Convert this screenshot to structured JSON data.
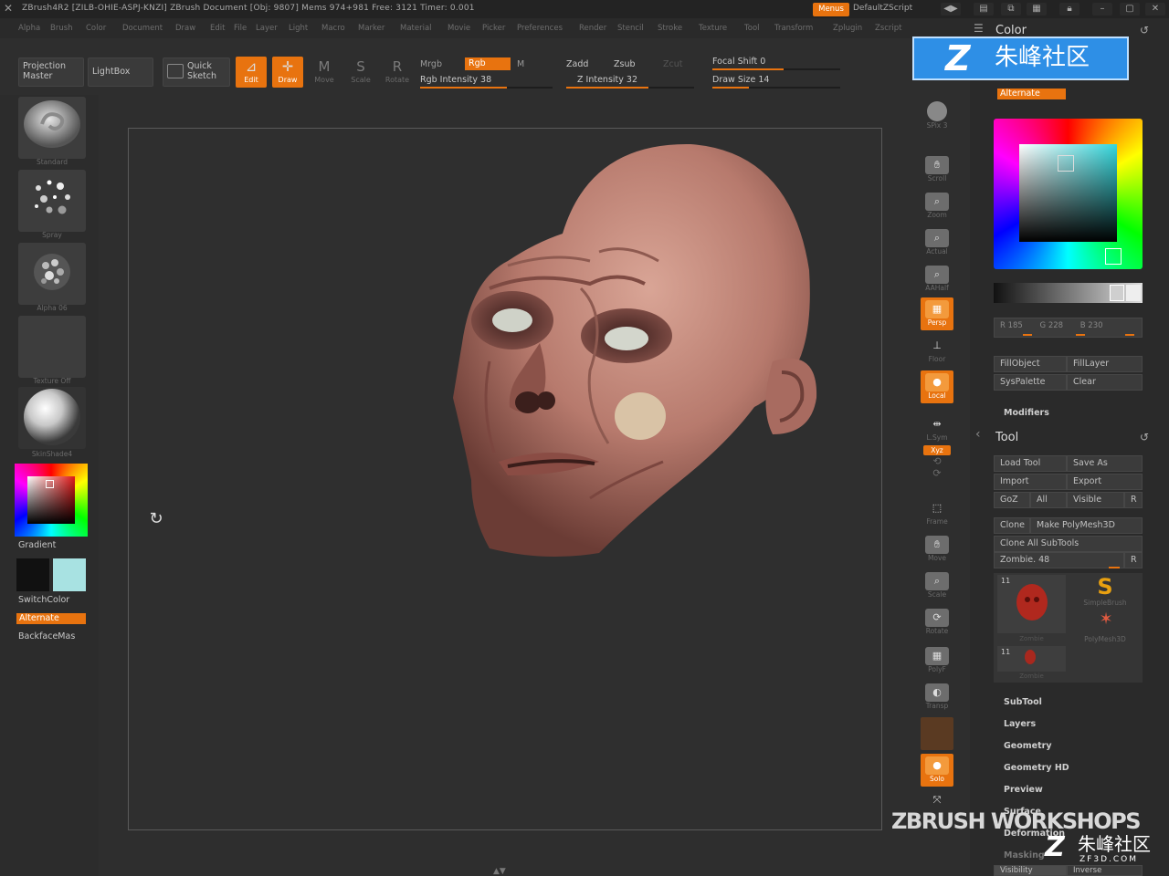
{
  "titlebar": {
    "text": "ZBrush4R2  [ZILB-OHIE-ASPJ-KNZI]    ZBrush Document     [Obj: 9807] Mems 974+981  Free: 3121  Timer: 0.001",
    "menus_label": "Menus",
    "script_label": "DefaultZScript"
  },
  "menubar": {
    "items": [
      "Alpha",
      "Brush",
      "Color",
      "Document",
      "Draw",
      "Edit",
      "File",
      "Layer",
      "Light",
      "Macro",
      "Marker",
      "Material",
      "Movie",
      "Picker",
      "Preferences",
      "Render",
      "Stencil",
      "Stroke",
      "Texture",
      "Tool",
      "Transform",
      "Zplugin",
      "Zscript"
    ]
  },
  "shelf": {
    "projection_master": "Projection Master",
    "lightbox": "LightBox",
    "quick_sketch": "Quick Sketch",
    "edit": "Edit",
    "draw": "Draw",
    "move": "Move",
    "scale": "Scale",
    "rotate": "Rotate",
    "mrgb": "Mrgb",
    "rgb": "Rgb",
    "m": "M",
    "rgb_intensity": "Rgb Intensity 38",
    "rgb_intensity_value": 38,
    "zadd": "Zadd",
    "zsub": "Zsub",
    "zcut": "Zcut",
    "z_intensity": "Z Intensity 32",
    "z_intensity_value": 32,
    "focal_shift": "Focal Shift 0",
    "focal_shift_value": 0,
    "draw_size": "Draw Size 14",
    "draw_size_value": 14
  },
  "lefttray": {
    "brush_label": "Standard",
    "stroke_label": "Spray",
    "alpha_label": "Alpha 06",
    "texture_label": "Texture Off",
    "material_label": "SkinShade4",
    "gradient": "Gradient",
    "switchcolor": "SwitchColor",
    "alternate": "Alternate",
    "backfacemask": "BackfaceMas"
  },
  "rightshelf": {
    "buttons": [
      "SPix",
      "Scroll",
      "Zoom",
      "Actual",
      "AAHalf",
      "Persp",
      "Floor",
      "Local",
      "L.Sym",
      "Xyz",
      "Frame",
      "Move",
      "Scale",
      "Rotate",
      "PolyF",
      "Transp",
      "Solo",
      "Xpose"
    ],
    "spix_value": "3"
  },
  "righttray": {
    "color_title": "Color",
    "alternate": "Alternate",
    "r": "R 185",
    "g": "G 228",
    "b": "B 230",
    "fillobject": "FillObject",
    "filllayer": "FillLayer",
    "syspalette": "SysPalette",
    "clear": "Clear",
    "modifiers": "Modifiers",
    "tool_title": "Tool",
    "load_tool": "Load Tool",
    "save_as": "Save As",
    "import": "Import",
    "export": "Export",
    "goz": "GoZ",
    "all": "All",
    "visible": "Visible",
    "r_btn": "R",
    "clone": "Clone",
    "make_polymesh": "Make PolyMesh3D",
    "clone_all": "Clone  All SubTools",
    "tool_slider": "Zombie. 48",
    "thumb_count": "11",
    "thumb2_count": "11",
    "tool_name": "Zombie",
    "simplebrush": "SimpleBrush",
    "polymesh3d": "PolyMesh3D",
    "sections": [
      "SubTool",
      "Layers",
      "Geometry",
      "Geometry HD",
      "Preview",
      "Surface",
      "Deformation",
      "Masking"
    ],
    "bottom_left": "Visibility",
    "bottom_right": "Inverse"
  },
  "watermarks": {
    "top_text": "朱峰社区",
    "brand": "ZBRUSH WORKSHOPS",
    "corner_text": "朱峰社区",
    "corner_sub": "ZF3D.COM"
  },
  "colors": {
    "accent": "#e8730f",
    "panel": "#2a2a2a",
    "canvas": "#2f2f2f"
  }
}
